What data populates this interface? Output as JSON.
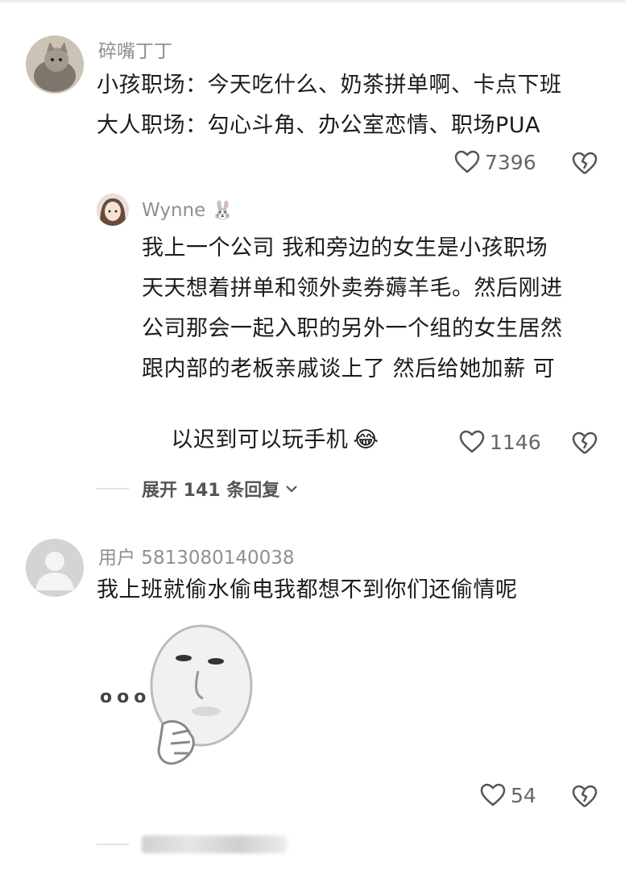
{
  "comments": [
    {
      "username": "碎嘴丁丁",
      "lines": [
        "小孩职场：今天吃什么、奶茶拼单啊、卡点下班",
        "大人职场：勾心斗角、办公室恋情、职场PUA"
      ],
      "likes": "7396"
    }
  ],
  "reply": {
    "username": "Wynne",
    "username_emoji": "🐰",
    "lines": [
      "我上一个公司 我和旁边的女生是小孩职场",
      "天天想着拼单和领外卖券薅羊毛。然后刚进",
      "公司那会一起入职的另外一个组的女生居然",
      "跟内部的老板亲戚谈上了 然后给她加薪 可",
      "以迟到可以玩手机"
    ],
    "emoji_end": "😂",
    "likes": "1146"
  },
  "expand_replies": "展开 141 条回复",
  "comment2": {
    "username": "用户 5813080140038",
    "text": "我上班就偷水偷电我都想不到你们还偷情呢",
    "sticker_dots": "ooo",
    "likes": "54"
  },
  "colors": {
    "muted": "#8f8f8f",
    "text": "#1c1c1c",
    "icon": "#555555"
  }
}
